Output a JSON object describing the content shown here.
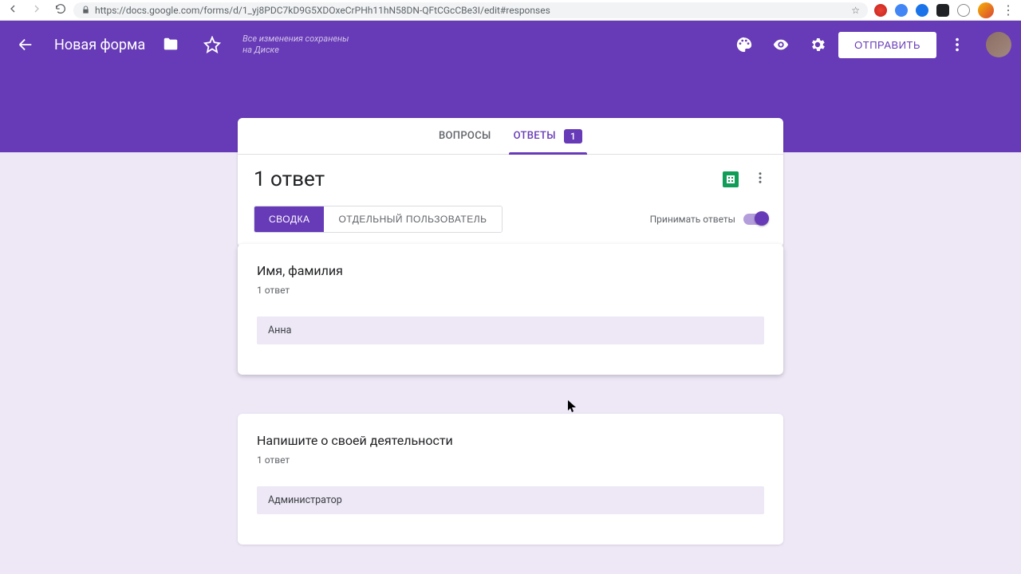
{
  "browser": {
    "url": "https://docs.google.com/forms/d/1_yj8PDC7kD9G5XDOxeCrPHh11hN58DN-QFtCGcCBe3I/edit#responses"
  },
  "header": {
    "title": "Новая форма",
    "save_status_l1": "Все изменения сохранены",
    "save_status_l2": "на Диске",
    "send_label": "ОТПРАВИТЬ"
  },
  "tabs": {
    "questions": "ВОПРОСЫ",
    "responses": "ОТВЕТЫ",
    "responses_badge": "1"
  },
  "responses": {
    "count_label": "1 ответ",
    "segments": {
      "summary": "СВОДКА",
      "individual": "ОТДЕЛЬНЫЙ ПОЛЬЗОВАТЕЛЬ"
    },
    "accepting_label": "Принимать ответы"
  },
  "questions": [
    {
      "title": "Имя, фамилия",
      "count": "1 ответ",
      "answer": "Анна"
    },
    {
      "title": "Напишите о своей деятельности",
      "count": "1 ответ",
      "answer": "Администратор"
    }
  ]
}
